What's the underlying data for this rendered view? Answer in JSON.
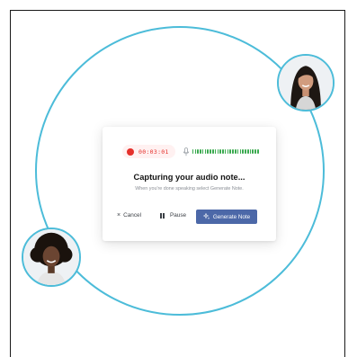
{
  "recorder": {
    "timer": "00:03:01"
  },
  "dialog": {
    "title": "Capturing your audio note...",
    "subtitle": "When you're done speaking select Generate Note."
  },
  "actions": {
    "cancel_label": "Cancel",
    "pause_label": "Pause",
    "generate_label": "Generate Note"
  },
  "icons": {
    "record": "record-dot-icon",
    "mic": "microphone-icon",
    "cancel": "close-icon",
    "pause": "pause-icon",
    "generate": "sparkles-icon"
  },
  "colors": {
    "accent": "#4c68a8",
    "ring": "#4cbcd9",
    "recording": "#e5302b",
    "waveform": "#3aaa4f"
  }
}
